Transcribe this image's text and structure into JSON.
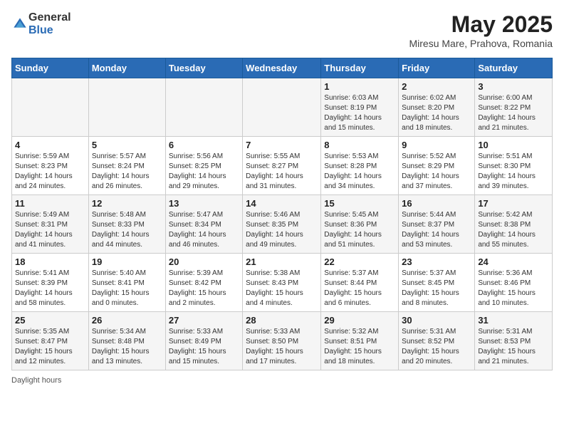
{
  "header": {
    "logo_general": "General",
    "logo_blue": "Blue",
    "title": "May 2025",
    "subtitle": "Miresu Mare, Prahova, Romania"
  },
  "columns": [
    "Sunday",
    "Monday",
    "Tuesday",
    "Wednesday",
    "Thursday",
    "Friday",
    "Saturday"
  ],
  "weeks": [
    [
      {
        "day": "",
        "detail": ""
      },
      {
        "day": "",
        "detail": ""
      },
      {
        "day": "",
        "detail": ""
      },
      {
        "day": "",
        "detail": ""
      },
      {
        "day": "1",
        "detail": "Sunrise: 6:03 AM\nSunset: 8:19 PM\nDaylight: 14 hours\nand 15 minutes."
      },
      {
        "day": "2",
        "detail": "Sunrise: 6:02 AM\nSunset: 8:20 PM\nDaylight: 14 hours\nand 18 minutes."
      },
      {
        "day": "3",
        "detail": "Sunrise: 6:00 AM\nSunset: 8:22 PM\nDaylight: 14 hours\nand 21 minutes."
      }
    ],
    [
      {
        "day": "4",
        "detail": "Sunrise: 5:59 AM\nSunset: 8:23 PM\nDaylight: 14 hours\nand 24 minutes."
      },
      {
        "day": "5",
        "detail": "Sunrise: 5:57 AM\nSunset: 8:24 PM\nDaylight: 14 hours\nand 26 minutes."
      },
      {
        "day": "6",
        "detail": "Sunrise: 5:56 AM\nSunset: 8:25 PM\nDaylight: 14 hours\nand 29 minutes."
      },
      {
        "day": "7",
        "detail": "Sunrise: 5:55 AM\nSunset: 8:27 PM\nDaylight: 14 hours\nand 31 minutes."
      },
      {
        "day": "8",
        "detail": "Sunrise: 5:53 AM\nSunset: 8:28 PM\nDaylight: 14 hours\nand 34 minutes."
      },
      {
        "day": "9",
        "detail": "Sunrise: 5:52 AM\nSunset: 8:29 PM\nDaylight: 14 hours\nand 37 minutes."
      },
      {
        "day": "10",
        "detail": "Sunrise: 5:51 AM\nSunset: 8:30 PM\nDaylight: 14 hours\nand 39 minutes."
      }
    ],
    [
      {
        "day": "11",
        "detail": "Sunrise: 5:49 AM\nSunset: 8:31 PM\nDaylight: 14 hours\nand 41 minutes."
      },
      {
        "day": "12",
        "detail": "Sunrise: 5:48 AM\nSunset: 8:33 PM\nDaylight: 14 hours\nand 44 minutes."
      },
      {
        "day": "13",
        "detail": "Sunrise: 5:47 AM\nSunset: 8:34 PM\nDaylight: 14 hours\nand 46 minutes."
      },
      {
        "day": "14",
        "detail": "Sunrise: 5:46 AM\nSunset: 8:35 PM\nDaylight: 14 hours\nand 49 minutes."
      },
      {
        "day": "15",
        "detail": "Sunrise: 5:45 AM\nSunset: 8:36 PM\nDaylight: 14 hours\nand 51 minutes."
      },
      {
        "day": "16",
        "detail": "Sunrise: 5:44 AM\nSunset: 8:37 PM\nDaylight: 14 hours\nand 53 minutes."
      },
      {
        "day": "17",
        "detail": "Sunrise: 5:42 AM\nSunset: 8:38 PM\nDaylight: 14 hours\nand 55 minutes."
      }
    ],
    [
      {
        "day": "18",
        "detail": "Sunrise: 5:41 AM\nSunset: 8:39 PM\nDaylight: 14 hours\nand 58 minutes."
      },
      {
        "day": "19",
        "detail": "Sunrise: 5:40 AM\nSunset: 8:41 PM\nDaylight: 15 hours\nand 0 minutes."
      },
      {
        "day": "20",
        "detail": "Sunrise: 5:39 AM\nSunset: 8:42 PM\nDaylight: 15 hours\nand 2 minutes."
      },
      {
        "day": "21",
        "detail": "Sunrise: 5:38 AM\nSunset: 8:43 PM\nDaylight: 15 hours\nand 4 minutes."
      },
      {
        "day": "22",
        "detail": "Sunrise: 5:37 AM\nSunset: 8:44 PM\nDaylight: 15 hours\nand 6 minutes."
      },
      {
        "day": "23",
        "detail": "Sunrise: 5:37 AM\nSunset: 8:45 PM\nDaylight: 15 hours\nand 8 minutes."
      },
      {
        "day": "24",
        "detail": "Sunrise: 5:36 AM\nSunset: 8:46 PM\nDaylight: 15 hours\nand 10 minutes."
      }
    ],
    [
      {
        "day": "25",
        "detail": "Sunrise: 5:35 AM\nSunset: 8:47 PM\nDaylight: 15 hours\nand 12 minutes."
      },
      {
        "day": "26",
        "detail": "Sunrise: 5:34 AM\nSunset: 8:48 PM\nDaylight: 15 hours\nand 13 minutes."
      },
      {
        "day": "27",
        "detail": "Sunrise: 5:33 AM\nSunset: 8:49 PM\nDaylight: 15 hours\nand 15 minutes."
      },
      {
        "day": "28",
        "detail": "Sunrise: 5:33 AM\nSunset: 8:50 PM\nDaylight: 15 hours\nand 17 minutes."
      },
      {
        "day": "29",
        "detail": "Sunrise: 5:32 AM\nSunset: 8:51 PM\nDaylight: 15 hours\nand 18 minutes."
      },
      {
        "day": "30",
        "detail": "Sunrise: 5:31 AM\nSunset: 8:52 PM\nDaylight: 15 hours\nand 20 minutes."
      },
      {
        "day": "31",
        "detail": "Sunrise: 5:31 AM\nSunset: 8:53 PM\nDaylight: 15 hours\nand 21 minutes."
      }
    ]
  ],
  "footer": {
    "daylight_label": "Daylight hours"
  }
}
